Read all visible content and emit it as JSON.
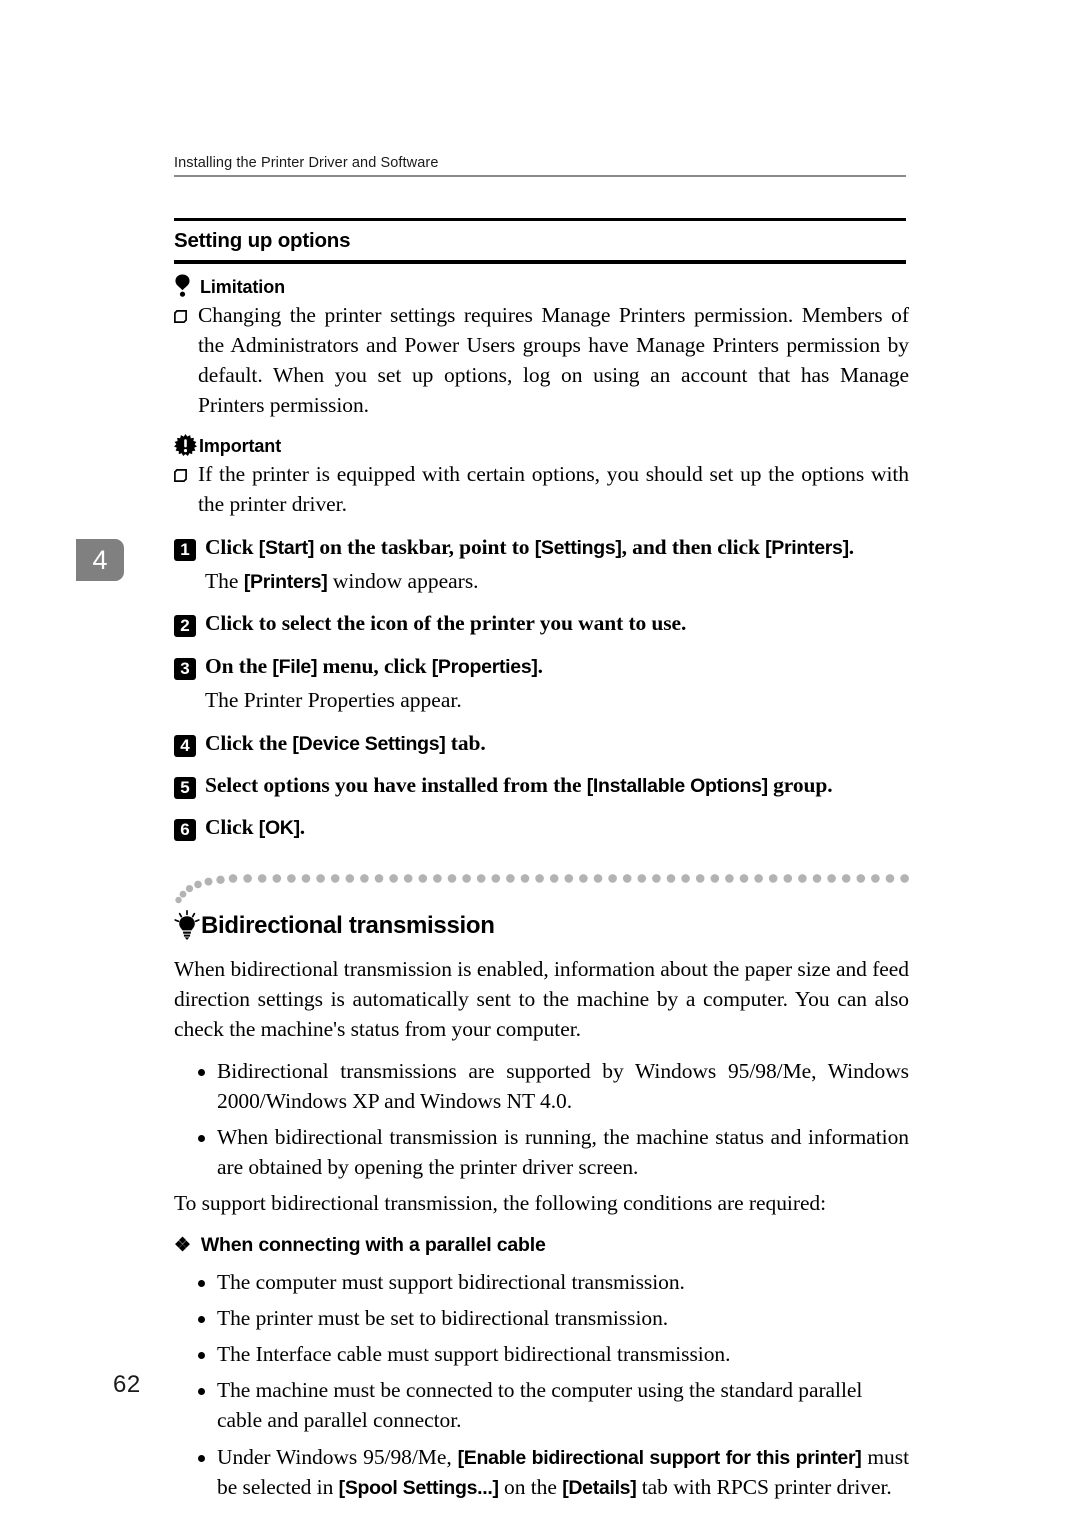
{
  "header": {
    "running_title": "Installing the Printer Driver and Software",
    "chapter_tab": "4",
    "page_number": "62"
  },
  "section": {
    "title": "Setting up options"
  },
  "limitation": {
    "icon": "exclamation-teardrop-icon",
    "label": "Limitation",
    "items": [
      "Changing the printer settings requires Manage Printers permission. Members of the Administrators and Power Users groups have Manage Printers permission by default. When you set up options, log on using an account that has Manage Printers permission."
    ]
  },
  "important": {
    "icon": "starburst-exclamation-icon",
    "label": "Important",
    "items": [
      "If the printer is equipped with certain options, you should set up the options with the printer driver."
    ]
  },
  "steps": [
    {
      "number": "1",
      "parts": [
        {
          "t": "Click ",
          "ui": false
        },
        {
          "t": "[Start]",
          "ui": true
        },
        {
          "t": " on the taskbar, point to ",
          "ui": false
        },
        {
          "t": "[Settings]",
          "ui": true
        },
        {
          "t": ", and then click ",
          "ui": false
        },
        {
          "t": "[Printers]",
          "ui": true
        },
        {
          "t": ".",
          "ui": false
        }
      ],
      "note_parts": [
        {
          "t": "The ",
          "ui": false
        },
        {
          "t": "[Printers]",
          "ui": true
        },
        {
          "t": " window appears.",
          "ui": false
        }
      ]
    },
    {
      "number": "2",
      "parts": [
        {
          "t": "Click to select the icon of the printer you want to use.",
          "ui": false
        }
      ],
      "note_parts": []
    },
    {
      "number": "3",
      "parts": [
        {
          "t": "On the ",
          "ui": false
        },
        {
          "t": "[File]",
          "ui": true
        },
        {
          "t": " menu, click ",
          "ui": false
        },
        {
          "t": "[Properties]",
          "ui": true
        },
        {
          "t": ".",
          "ui": false
        }
      ],
      "note_parts": [
        {
          "t": "The Printer Properties appear.",
          "ui": false
        }
      ]
    },
    {
      "number": "4",
      "parts": [
        {
          "t": "Click the ",
          "ui": false
        },
        {
          "t": "[Device Settings]",
          "ui": true
        },
        {
          "t": " tab.",
          "ui": false
        }
      ],
      "note_parts": []
    },
    {
      "number": "5",
      "parts": [
        {
          "t": "Select options you have installed from the ",
          "ui": false
        },
        {
          "t": "[Installable Options]",
          "ui": true
        },
        {
          "t": " group.",
          "ui": false
        }
      ],
      "note_parts": []
    },
    {
      "number": "6",
      "parts": [
        {
          "t": "Click ",
          "ui": false
        },
        {
          "t": "[OK]",
          "ui": true
        },
        {
          "t": ".",
          "ui": false
        }
      ],
      "note_parts": []
    }
  ],
  "tip": {
    "icon": "lightbulb-icon",
    "title": "Bidirectional transmission",
    "intro": "When bidirectional transmission is enabled, information about the paper size and feed direction settings is automatically sent to the machine by a computer. You can also check the machine's status from your computer.",
    "bullets": [
      "Bidirectional transmissions are supported by Windows 95/98/Me, Windows 2000/Windows XP and Windows NT 4.0.",
      "When bidirectional transmission is running, the machine status and information are obtained by opening the printer driver screen."
    ],
    "closing": "To support bidirectional transmission, the following conditions are required:",
    "subsection": {
      "marker": "❖",
      "title": "When connecting with a parallel cable",
      "bullets": [
        [
          {
            "t": "The computer must support bidirectional transmission.",
            "ui": false
          }
        ],
        [
          {
            "t": "The printer must be set to bidirectional transmission.",
            "ui": false
          }
        ],
        [
          {
            "t": "The Interface cable must support bidirectional transmission.",
            "ui": false
          }
        ],
        [
          {
            "t": "The machine must be connected to the computer using the standard parallel cable and parallel connector.",
            "ui": false
          }
        ],
        [
          {
            "t": "Under Windows 95/98/Me, ",
            "ui": false
          },
          {
            "t": "[Enable bidirectional support for this printer]",
            "ui": true
          },
          {
            "t": " must be selected in ",
            "ui": false
          },
          {
            "t": "[Spool Settings...]",
            "ui": true
          },
          {
            "t": " on the ",
            "ui": false
          },
          {
            "t": "[Details]",
            "ui": true
          },
          {
            "t": " tab with RPCS printer driver.",
            "ui": false
          }
        ]
      ]
    }
  },
  "colors": {
    "rule": "#000000",
    "rule_light": "#8a8a8a",
    "chapter_tab_bg": "#808080",
    "dot": "#b3b3b3"
  }
}
